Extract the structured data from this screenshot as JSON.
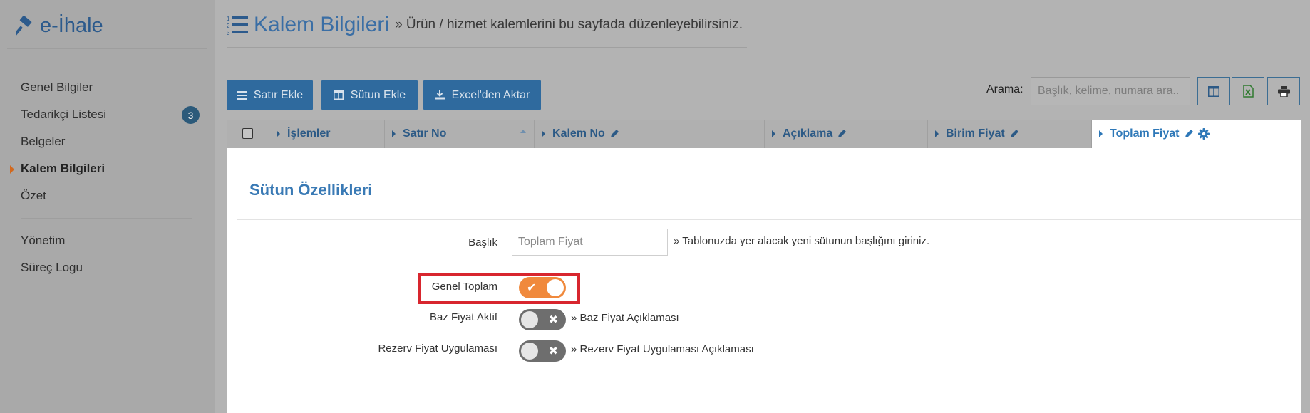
{
  "app": {
    "logo_text": "e-İhale"
  },
  "sidebar": {
    "items": [
      {
        "label": "Genel Bilgiler"
      },
      {
        "label": "Tedarikçi Listesi",
        "badge": "3"
      },
      {
        "label": "Belgeler"
      },
      {
        "label": "Kalem Bilgileri",
        "active": true
      },
      {
        "label": "Özet"
      }
    ],
    "items2": [
      {
        "label": "Yönetim"
      },
      {
        "label": "Süreç Logu"
      }
    ]
  },
  "header": {
    "title": "Kalem Bilgileri",
    "subtitle": "» Ürün / hizmet kalemlerini bu sayfada düzenleyebilirsiniz."
  },
  "toolbar": {
    "add_row": "Satır Ekle",
    "add_column": "Sütun Ekle",
    "excel_import": "Excel'den Aktar",
    "search_label": "Arama:",
    "search_placeholder": "Başlık, kelime, numara ara.."
  },
  "table": {
    "columns": [
      {
        "label": "İşlemler"
      },
      {
        "label": "Satır No"
      },
      {
        "label": "Kalem No"
      },
      {
        "label": "Açıklama"
      },
      {
        "label": "Birim Fiyat"
      },
      {
        "label": "Toplam Fiyat"
      }
    ]
  },
  "panel": {
    "title": "Sütun Özellikleri",
    "title_field_label": "Başlık",
    "title_field_value": "",
    "title_field_placeholder": "Toplam Fiyat",
    "title_field_hint": "» Tablonuzda yer alacak yeni sütunun başlığını giriniz.",
    "options": [
      {
        "label": "Genel Toplam",
        "on": true,
        "hint": ""
      },
      {
        "label": "Baz Fiyat Aktif",
        "on": false,
        "hint": "» Baz Fiyat Açıklaması"
      },
      {
        "label": "Rezerv Fiyat Uygulaması",
        "on": false,
        "hint": "» Rezerv Fiyat Uygulaması Açıklaması"
      }
    ]
  },
  "colors": {
    "accent": "#2f6a9e",
    "toggle_on": "#f0893c",
    "highlight": "#d8262e"
  }
}
